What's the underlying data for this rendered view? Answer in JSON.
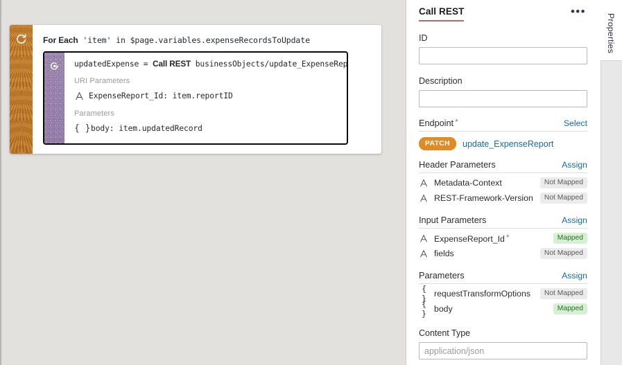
{
  "canvas": {
    "foreach": {
      "icon": "loop-icon",
      "title_prefix": "For Each",
      "title_rest": " 'item' in $page.variables.expenseRecordsToUpdate",
      "stripe_color": "#c0721a"
    },
    "rest_action": {
      "icon": "call-rest-icon",
      "headline_var": "updatedExpense = ",
      "headline_verb": "Call REST",
      "headline_endpoint": " businessObjects/update_ExpenseReport",
      "groups": [
        {
          "label": "URI Parameters",
          "rows": [
            {
              "icon": "string-type-icon",
              "text": "ExpenseReport_Id: item.reportID"
            }
          ]
        },
        {
          "label": "Parameters",
          "rows": [
            {
              "icon": "object-type-icon",
              "brace": "{ }",
              "text": "body: item.updatedRecord"
            }
          ]
        }
      ],
      "stripe_color": "#9077a6",
      "selected": true
    }
  },
  "properties": {
    "tab_label": "Call REST",
    "accent_color": "#c9655c",
    "overflow_menu": "•••",
    "fields": [
      {
        "label": "ID",
        "value": "",
        "placeholder": ""
      },
      {
        "label": "Description",
        "value": "",
        "placeholder": ""
      }
    ],
    "endpoint": {
      "label": "Endpoint",
      "required": true,
      "action": "Select",
      "method": "PATCH",
      "method_color": "#e08b23",
      "name": "update_ExpenseReport"
    },
    "sections": [
      {
        "title": "Header Parameters",
        "action": "Assign",
        "rows": [
          {
            "icon": "string-type-icon",
            "name": "Metadata-Context",
            "status": "Not Mapped",
            "mapped": false,
            "required": false
          },
          {
            "icon": "string-type-icon",
            "name": "REST-Framework-Version",
            "status": "Not Mapped",
            "mapped": false,
            "required": false
          }
        ]
      },
      {
        "title": "Input Parameters",
        "action": "Assign",
        "rows": [
          {
            "icon": "string-type-icon",
            "name": "ExpenseReport_Id",
            "status": "Mapped",
            "mapped": true,
            "required": true
          },
          {
            "icon": "string-type-icon",
            "name": "fields",
            "status": "Not Mapped",
            "mapped": false,
            "required": false
          }
        ]
      },
      {
        "title": "Parameters",
        "action": "Assign",
        "rows": [
          {
            "icon": "object-type-icon",
            "brace": "{ }",
            "name": "requestTransformOptions",
            "status": "Not Mapped",
            "mapped": false,
            "required": false
          },
          {
            "icon": "object-type-icon",
            "brace": "{ }",
            "name": "body",
            "status": "Mapped",
            "mapped": true,
            "required": false
          }
        ]
      }
    ],
    "content_type": {
      "label": "Content Type",
      "value": "",
      "placeholder": "application/json"
    }
  },
  "rail": {
    "tab_label": "Properties"
  }
}
